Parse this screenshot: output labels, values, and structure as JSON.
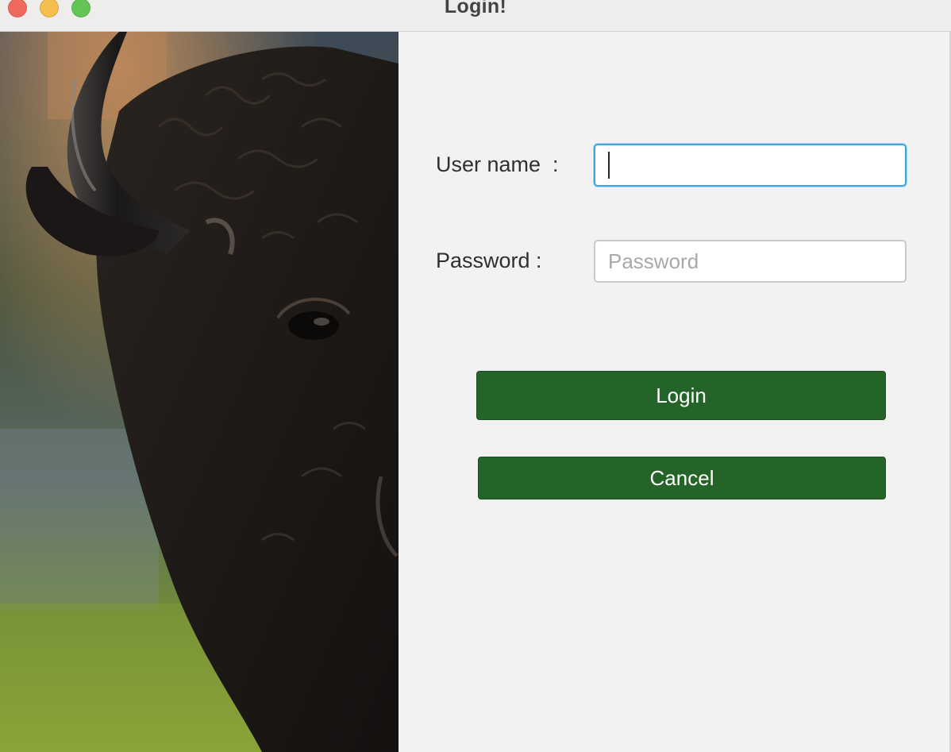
{
  "window": {
    "title": "Login!"
  },
  "image": {
    "description_icon": "bison-statue-photo"
  },
  "form": {
    "username_label": "User name  :",
    "username_value": "",
    "password_label": "Password :",
    "password_placeholder": "Password",
    "login_button": "Login",
    "cancel_button": "Cancel"
  },
  "colors": {
    "button_green": "#256428",
    "focus_blue": "#3ea6dd",
    "close": "#ee6a5f",
    "minimize": "#f5bf4f",
    "maximize": "#62c554"
  }
}
